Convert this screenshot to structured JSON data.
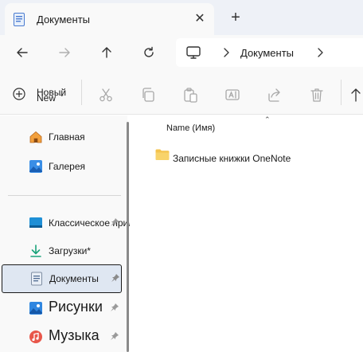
{
  "tab": {
    "title": "Документы",
    "close_glyph": "✕",
    "new_tab_glyph": "+"
  },
  "nav": {
    "address_location": "Документы"
  },
  "commands": {
    "new_label_main": "Новый",
    "new_label_alt": "New",
    "new_caret": "⌄",
    "icons": [
      "cut-icon",
      "copy-icon",
      "paste-icon",
      "rename-icon",
      "share-icon",
      "delete-icon",
      "sort-icon"
    ]
  },
  "sidebar": {
    "items": [
      {
        "label": "Главная",
        "icon": "home-icon"
      },
      {
        "label": "Галерея",
        "icon": "gallery-icon"
      },
      {
        "label": "Классическое приложение",
        "icon": "desktop-icon",
        "pinned": true
      },
      {
        "label": "Загрузки*",
        "icon": "downloads-icon"
      },
      {
        "label": "Документы",
        "icon": "documents-icon",
        "pinned": true,
        "selected": true
      },
      {
        "label": "Рисунки",
        "icon": "pictures-icon",
        "pinned": true
      },
      {
        "label": "Музыка",
        "icon": "music-icon",
        "pinned": true
      }
    ]
  },
  "content": {
    "sort_caret": "⌃",
    "column_name": "Name (Имя)",
    "files": [
      {
        "name": "Записные книжки OneNote",
        "icon": "folder-icon"
      }
    ]
  },
  "colors": {
    "accent": "#0067c0",
    "folder": "#f4c34d",
    "selected_bg": "#dfe7f2"
  }
}
